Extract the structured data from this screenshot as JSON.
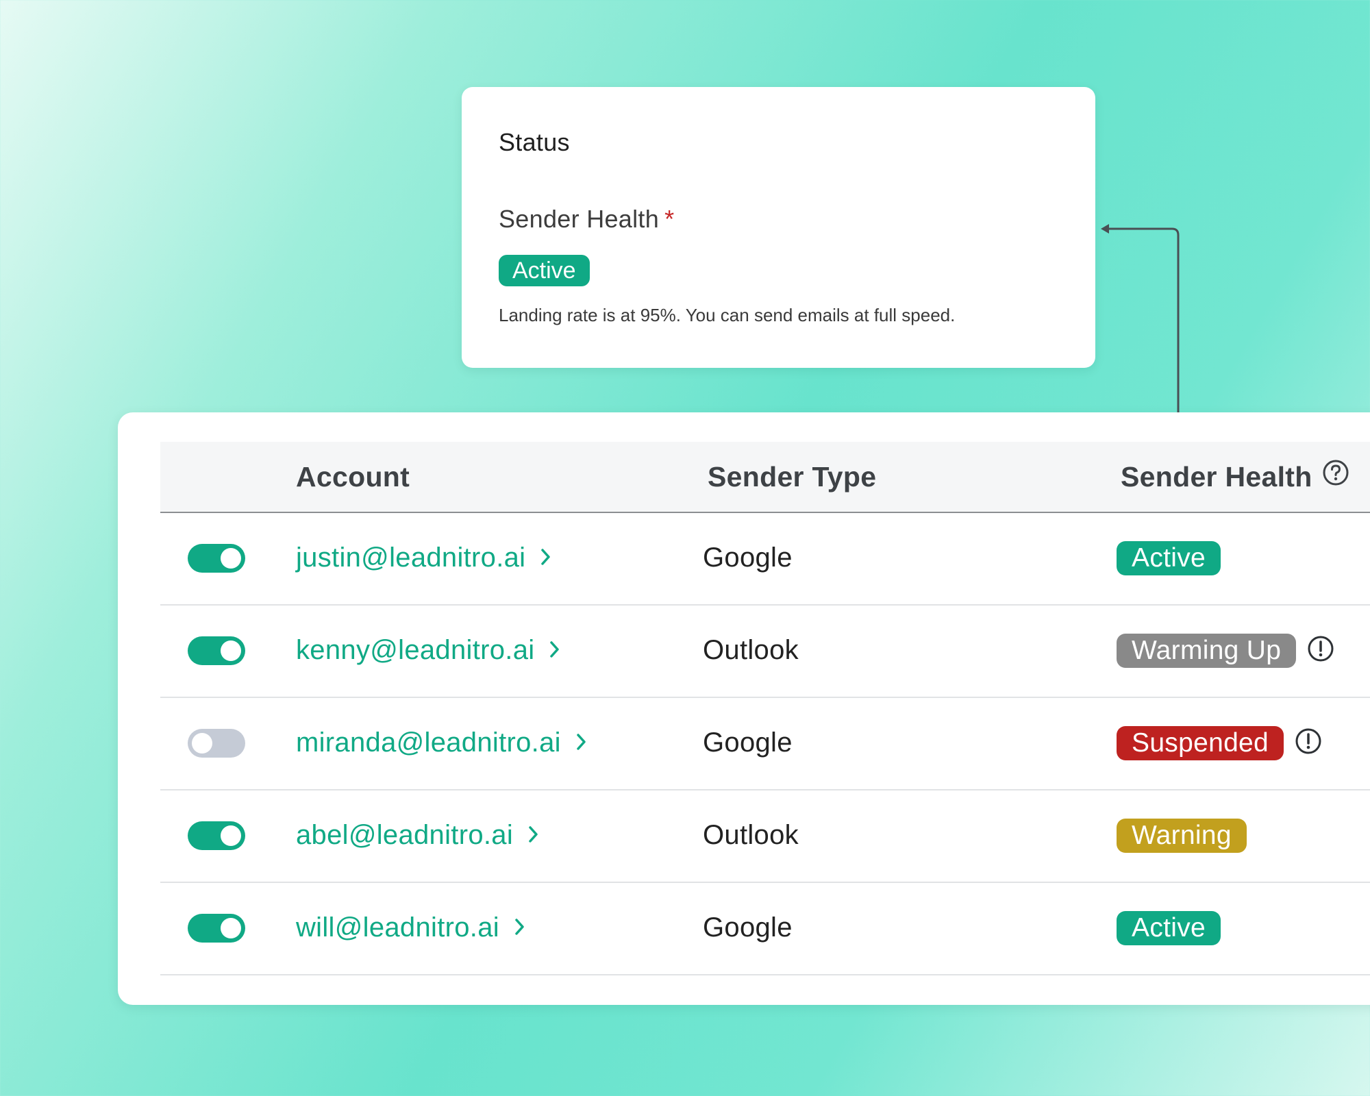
{
  "status_card": {
    "title": "Status",
    "field_label": "Sender Health",
    "required_mark": "*",
    "badge": "Active",
    "description": "Landing rate is at 95%. You can send emails at full speed."
  },
  "table": {
    "headers": {
      "account": "Account",
      "sender_type": "Sender Type",
      "sender_health": "Sender Health"
    },
    "rows": [
      {
        "enabled": true,
        "account": "justin@leadnitro.ai",
        "sender_type": "Google",
        "health": "Active",
        "health_color": "#10a985",
        "alert": false
      },
      {
        "enabled": true,
        "account": "kenny@leadnitro.ai",
        "sender_type": "Outlook",
        "health": "Warming Up",
        "health_color": "#898989",
        "alert": true
      },
      {
        "enabled": false,
        "account": "miranda@leadnitro.ai",
        "sender_type": "Google",
        "health": "Suspended",
        "health_color": "#be2220",
        "alert": true
      },
      {
        "enabled": true,
        "account": "abel@leadnitro.ai",
        "sender_type": "Outlook",
        "health": "Warning",
        "health_color": "#c2a01e",
        "alert": false
      },
      {
        "enabled": true,
        "account": "will@leadnitro.ai",
        "sender_type": "Google",
        "health": "Active",
        "health_color": "#10a985",
        "alert": false
      }
    ]
  },
  "colors": {
    "accent": "#10a985",
    "toggle_off": "#c5cbd6"
  },
  "icons": {
    "help": "question-circle-icon",
    "alert": "exclamation-circle-icon",
    "chevron": "chevron-right-icon"
  }
}
